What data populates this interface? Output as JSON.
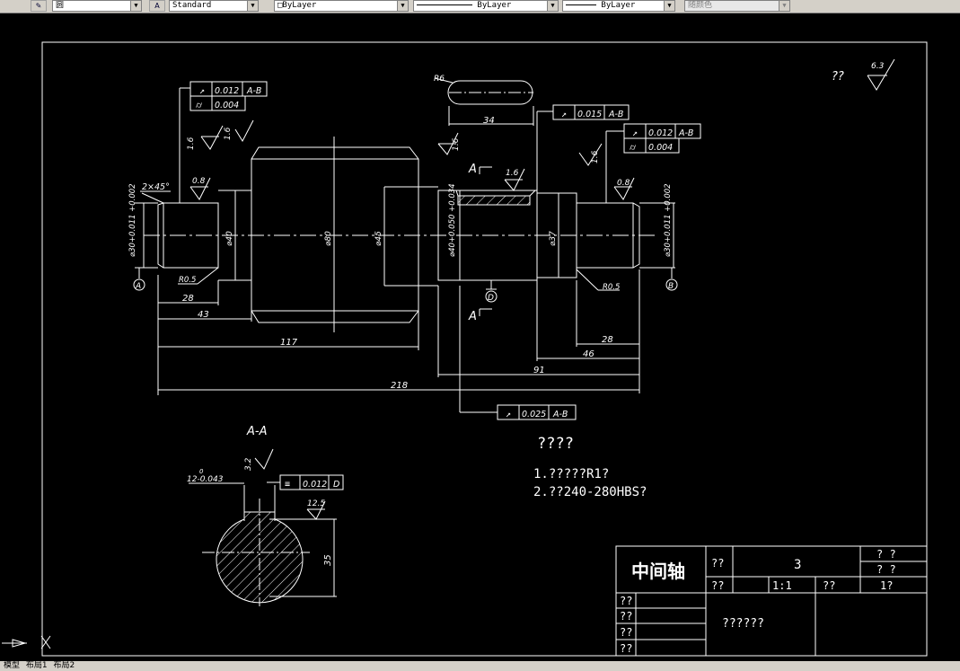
{
  "toolbar": {
    "linetype_glyph": "圆",
    "text_style": "Standard",
    "layer": "ByLayer",
    "linetype": "ByLayer",
    "lineweight": "ByLayer",
    "color": "随颜色"
  },
  "status_tabs": [
    "模型",
    "布局1",
    "布局2"
  ],
  "dims": {
    "d_30_left": "⌀30+0.011 +0.002",
    "d_40": "⌀40",
    "d_80": "⌀80",
    "d_45": "⌀45",
    "d_40b": "⌀40+0.050 +0.034",
    "d_37": "⌀37",
    "d_30_right": "⌀30+0.011 +0.002",
    "l_28": "28",
    "l_43": "43",
    "l_117": "117",
    "l_218": "218",
    "l_91": "91",
    "l_46": "46",
    "l_28b": "28",
    "l_34": "34",
    "l_35": "35",
    "r6": "R6",
    "r05_left": "R0.5",
    "r05_right": "R0.5",
    "chamfer": "2×45°",
    "key_w": "12-0.043",
    "key_sup": "0"
  },
  "tolerances": {
    "t1_val": "0.012",
    "t1_ref": "A-B",
    "t2_val": "0.004",
    "t3_val": "0.015",
    "t3_ref": "A-B",
    "t4_val": "0.012",
    "t4_ref": "A-B",
    "t5_val": "0.004",
    "t6_val": "0.025",
    "t6_ref": "A-B",
    "t7_val": "0.012",
    "t7_ref": "D"
  },
  "roughness": {
    "r1": "1.6",
    "r2": "1.6",
    "r3": "1.6",
    "r4": "1.6",
    "r5": "1.6",
    "r6": "0.8",
    "r7": "0.8",
    "r8": "3.2",
    "r9": "12.5",
    "corner": "6.3",
    "corner_q": "??"
  },
  "datums": {
    "a": "A",
    "b": "B",
    "d": "D",
    "sec1": "A",
    "sec2": "A"
  },
  "section_label": "A-A",
  "notes": {
    "title": "????",
    "line1": "1.?????R1?",
    "line2": "2.??240-280HBS?"
  },
  "title_block": {
    "part_name": "中间轴",
    "c_label1": "??",
    "qty": "3",
    "c_q1": "? ?",
    "c_q2": "? ?",
    "c_label2": "??",
    "scale": "1:1",
    "c_label3": "??",
    "c_label4": "1?",
    "rows": [
      "??",
      "??",
      "??",
      "??"
    ],
    "school": "??????"
  },
  "colors": {
    "background": "#000000",
    "line": "#ffffff",
    "toolbar": "#d4d0c8"
  }
}
